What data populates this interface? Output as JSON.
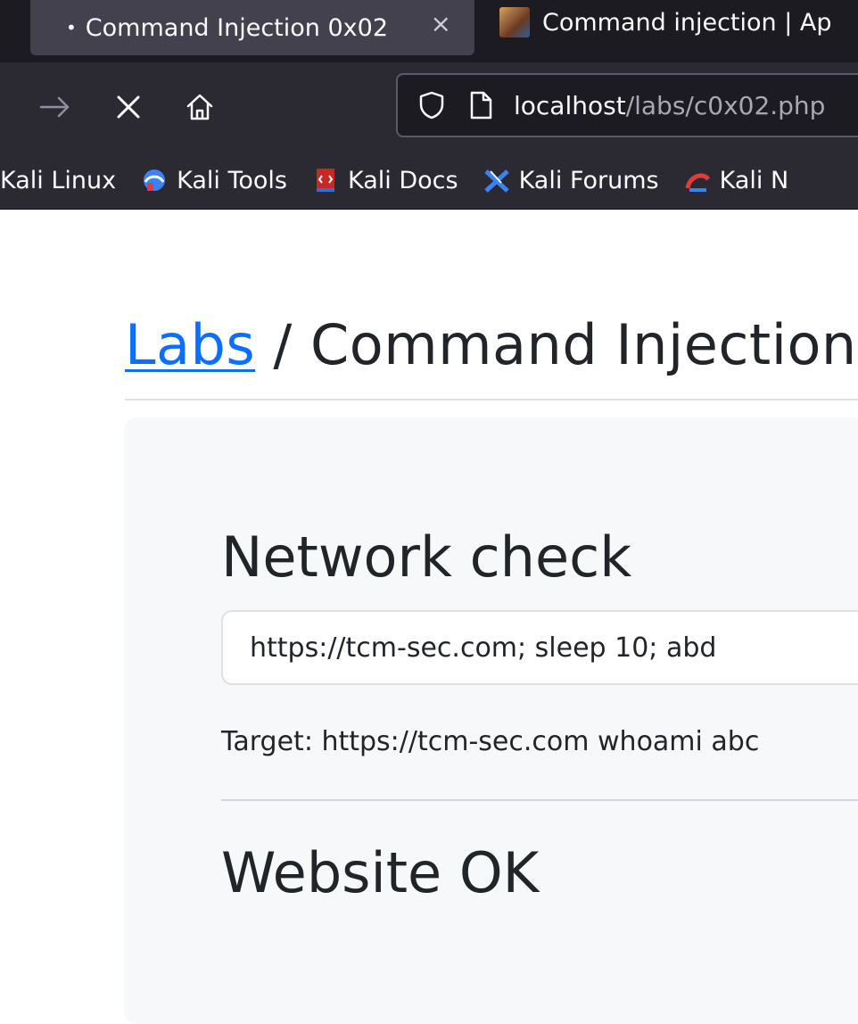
{
  "browser": {
    "tabs": [
      {
        "title": "Command Injection 0x02",
        "active": true,
        "close_glyph": "×"
      },
      {
        "title": "Command injection | Ap",
        "active": false
      }
    ],
    "address": {
      "host": "localhost",
      "path": "/labs/c0x02.php"
    },
    "bookmarks": [
      {
        "label": "Kali Linux",
        "icon": "kali-dragon-icon"
      },
      {
        "label": "Kali Tools",
        "icon": "kali-tools-icon"
      },
      {
        "label": "Kali Docs",
        "icon": "kali-docs-icon"
      },
      {
        "label": "Kali Forums",
        "icon": "kali-forums-icon"
      },
      {
        "label": "Kali N",
        "icon": "kali-nethunter-icon"
      }
    ],
    "colors": {
      "tabbar_bg": "#1c1b22",
      "navbar_bg": "#2b2a33",
      "active_tab_bg": "#42414d"
    }
  },
  "page": {
    "breadcrumb": {
      "link": "Labs",
      "separator": " / ",
      "current": "Command Injection"
    },
    "card": {
      "title": "Network check",
      "input_value": "https://tcm-sec.com; sleep 10; abd",
      "target_line": "Target: https://tcm-sec.com whoami abc",
      "result": "Website OK"
    },
    "colors": {
      "link": "#0d6efd",
      "text": "#212529",
      "card_bg": "#f7f8f9"
    }
  }
}
